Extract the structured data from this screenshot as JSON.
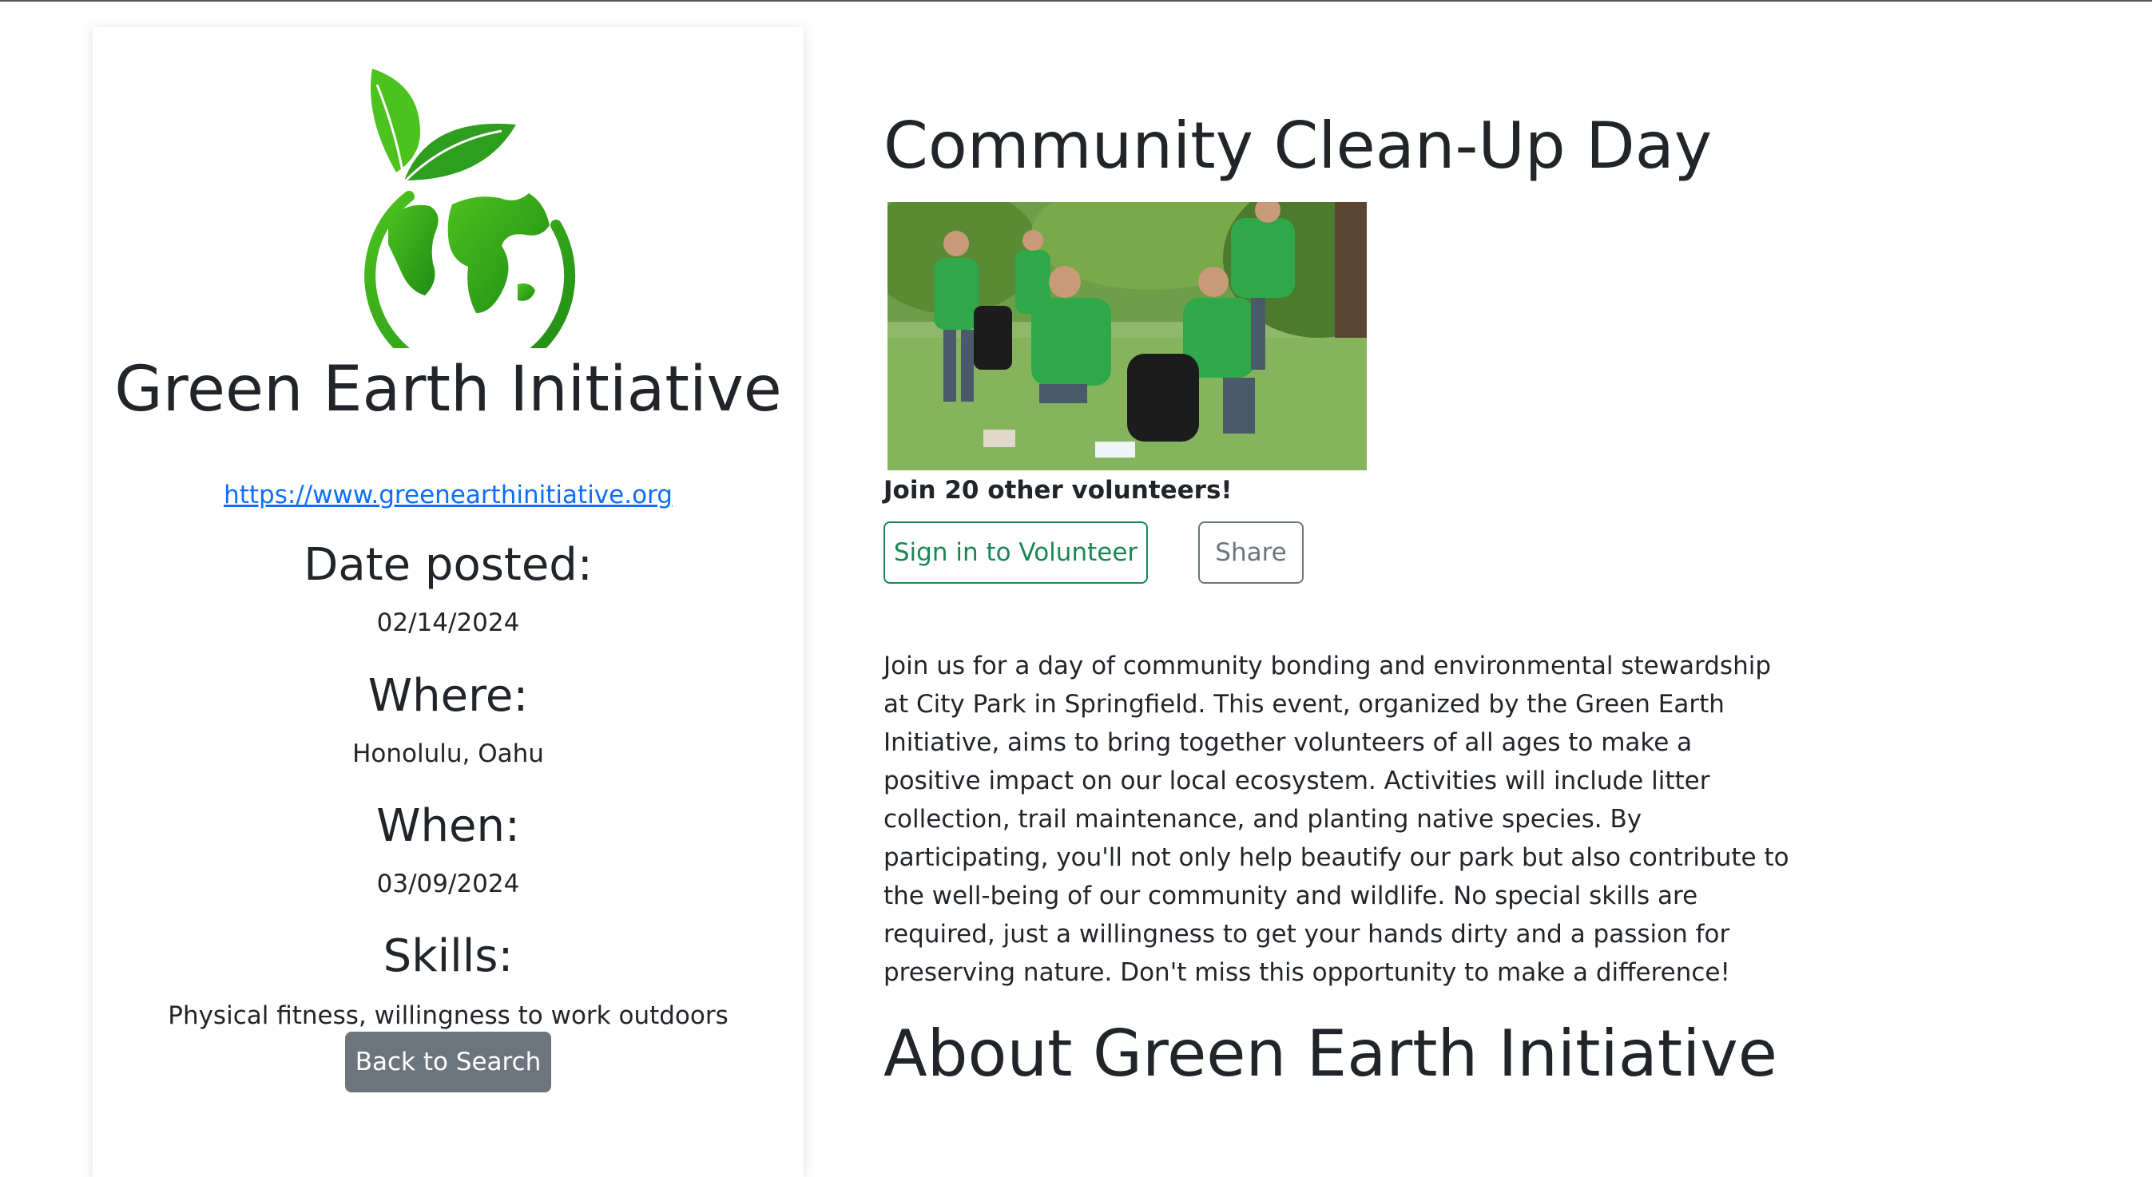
{
  "org": {
    "name": "Green Earth Initiative",
    "url": "https://www.greenearthinitiative.org",
    "logo_icon": "leaf-globe-logo"
  },
  "details": {
    "date_posted_label": "Date posted:",
    "date_posted_value": "02/14/2024",
    "where_label": "Where:",
    "where_value": "Honolulu, Oahu",
    "when_label": "When:",
    "when_value": "03/09/2024",
    "skills_label": "Skills:",
    "skills_value": "Physical fitness, willingness to work outdoors"
  },
  "buttons": {
    "back": "Back to Search",
    "volunteer": "Sign in to Volunteer",
    "share": "Share"
  },
  "event": {
    "title": "Community Clean-Up Day",
    "volunteers_text": "Join 20 other volunteers!",
    "description": "Join us for a day of community bonding and environmental stewardship at City Park in Springfield. This event, organized by the Green Earth Initiative, aims to bring together volunteers of all ages to make a positive impact on our local ecosystem. Activities will include litter collection, trail maintenance, and planting native species. By participating, you'll not only help beautify our park but also contribute to the well-being of our community and wildlife. No special skills are required, just a willingness to get your hands dirty and a passion for preserving nature. Don't miss this opportunity to make a difference!"
  },
  "about": {
    "title": "About Green Earth Initiative"
  },
  "colors": {
    "brand_green": "#2e9e1f",
    "volunteer_outline": "#198754",
    "secondary": "#6c757d",
    "link": "#0d6efd"
  }
}
